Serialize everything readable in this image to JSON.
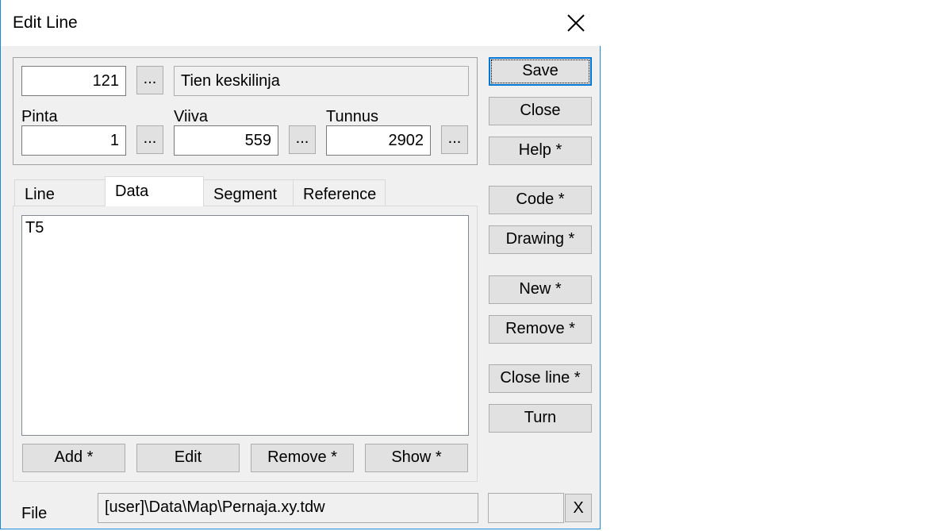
{
  "window": {
    "title": "Edit Line"
  },
  "header": {
    "code_value": "121",
    "code_description": "Tien keskilinja",
    "browse_label": "...",
    "pinta_label": "Pinta",
    "pinta_value": "1",
    "viiva_label": "Viiva",
    "viiva_value": "559",
    "tunnus_label": "Tunnus",
    "tunnus_value": "2902"
  },
  "tabs": [
    {
      "label": "Line"
    },
    {
      "label": "Data",
      "active": true
    },
    {
      "label": "Segment"
    },
    {
      "label": "Reference"
    }
  ],
  "data_tab": {
    "items": [
      "T5"
    ],
    "buttons": {
      "add": "Add *",
      "edit": "Edit",
      "remove": "Remove *",
      "show": "Show *"
    }
  },
  "side_buttons": {
    "save": "Save",
    "close": "Close",
    "help": "Help *",
    "code": "Code *",
    "drawing": "Drawing *",
    "new": "New *",
    "remove": "Remove *",
    "close_line": "Close line *",
    "turn": "Turn"
  },
  "footer": {
    "file_label": "File",
    "file_path": "[user]\\Data\\Map\\Pernaja.xy.tdw",
    "extra_value": "",
    "clear_label": "X"
  },
  "icons": {
    "window_close": "close-icon"
  },
  "colors": {
    "accent": "#0078d7",
    "border": "#1e88d6"
  }
}
